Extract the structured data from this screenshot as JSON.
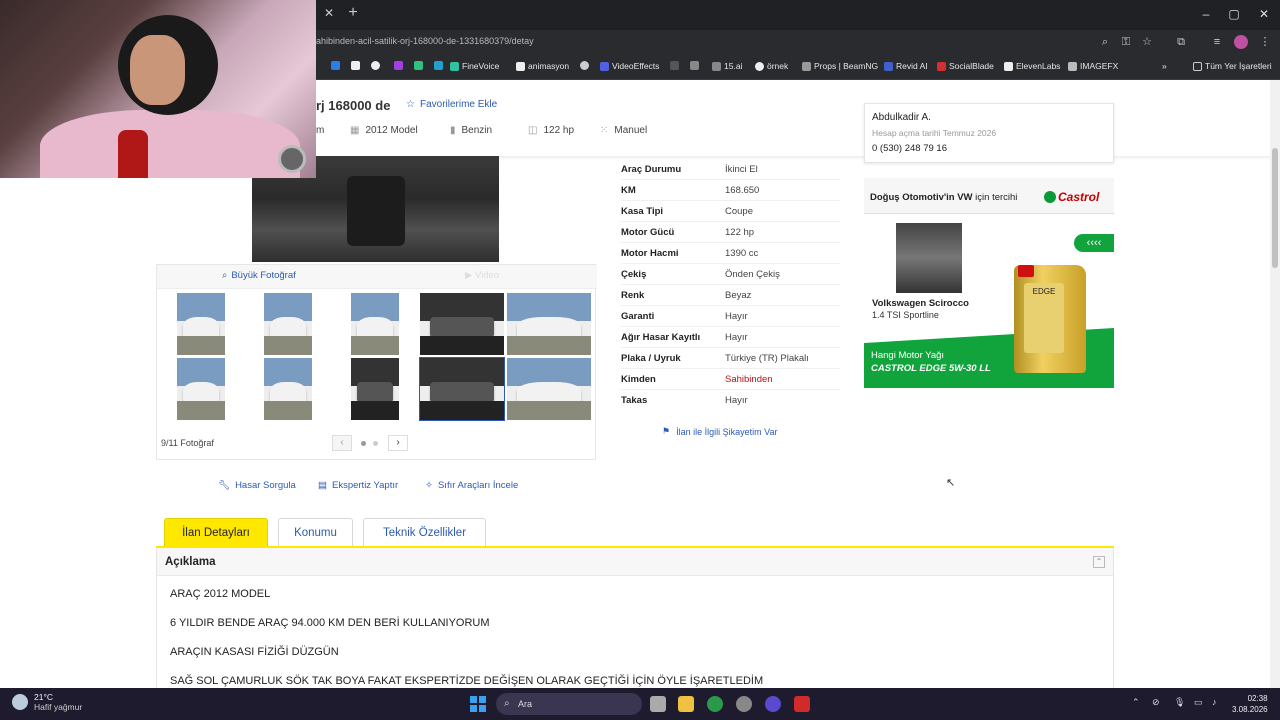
{
  "browser": {
    "url": "ahibinden-acil-satilik-orj-168000-de-1331680379/detay",
    "bookmarks": [
      "FineVoice",
      "animasyon",
      "VideoEffects",
      "15.ai",
      "örnek",
      "Props | BeamNG",
      "Revid AI",
      "SocialBlade",
      "ElevenLabs",
      "IMAGEFX"
    ],
    "all_bookmarks": "Tüm Yer İşaretleri"
  },
  "header": {
    "title_fragment": "rj 168000 de",
    "favorite": "Favorilerime Ekle",
    "chip_partial": "m",
    "chips": [
      "2012 Model",
      "Benzin",
      "122 hp",
      "Manuel"
    ]
  },
  "seller": {
    "name": "Abdulkadir A.",
    "since": "Hesap açma tarihi  Temmuz 2026",
    "phone": "0 (530) 248 79 16"
  },
  "gallery": {
    "big_photo": "Büyük Fotoğraf",
    "video": "Video",
    "counter": "9/11 Fotoğraf"
  },
  "details": [
    {
      "key": "Araç Durumu",
      "value": "İkinci El"
    },
    {
      "key": "KM",
      "value": "168.650"
    },
    {
      "key": "Kasa Tipi",
      "value": "Coupe"
    },
    {
      "key": "Motor Gücü",
      "value": "122 hp"
    },
    {
      "key": "Motor Hacmi",
      "value": "1390 cc"
    },
    {
      "key": "Çekiş",
      "value": "Önden Çekiş"
    },
    {
      "key": "Renk",
      "value": "Beyaz"
    },
    {
      "key": "Garanti",
      "value": "Hayır"
    },
    {
      "key": "Ağır Hasar Kayıtlı",
      "value": "Hayır"
    },
    {
      "key": "Plaka / Uyruk",
      "value": "Türkiye (TR) Plakalı"
    },
    {
      "key": "Kimden",
      "value": "Sahibinden"
    },
    {
      "key": "Takas",
      "value": "Hayır"
    }
  ],
  "complaint": "İlan ile İlgili Şikayetim Var",
  "ad": {
    "head_bold": "Doğuş Otomotiv'in VW",
    "head_rest": " için tercihi",
    "brand": "Castrol",
    "model": "Volkswagen Scirocco",
    "sub": "1.4 TSI Sportline",
    "tag": "‹‹‹‹",
    "q1": "Hangi Motor Yağı",
    "q2": "CASTROL EDGE 5W-30 LL",
    "oil_label": "EDGE"
  },
  "actions": [
    "Hasar Sorgula",
    "Ekspertiz Yaptır",
    "Sıfır Araçları İncele"
  ],
  "tabs": [
    "İlan Detayları",
    "Konumu",
    "Teknik Özellikler"
  ],
  "description": {
    "title": "Açıklama",
    "lines": [
      "ARAÇ 2012 MODEL",
      "6 YILDIR BENDE ARAÇ 94.000 KM DEN BERİ KULLANIYORUM",
      "ARAÇIN KASASI FİZİĞİ DÜZGÜN",
      "SAĞ SOL ÇAMURLUK SÖK TAK BOYA FAKAT EKSPERTİZDE DEĞİŞEN OLARAK GEÇTİĞİ İÇİN ÖYLE İŞARETLEDİM"
    ]
  },
  "taskbar": {
    "temp": "21°C",
    "weather": "Hafif yağmur",
    "search": "Ara",
    "time": "02:38",
    "date": "3.08.2026"
  },
  "colors": {
    "accent": "#2b5bb3",
    "tab_active": "#ffe800",
    "ad_green": "#12a43c",
    "brand_red": "#c40000"
  }
}
